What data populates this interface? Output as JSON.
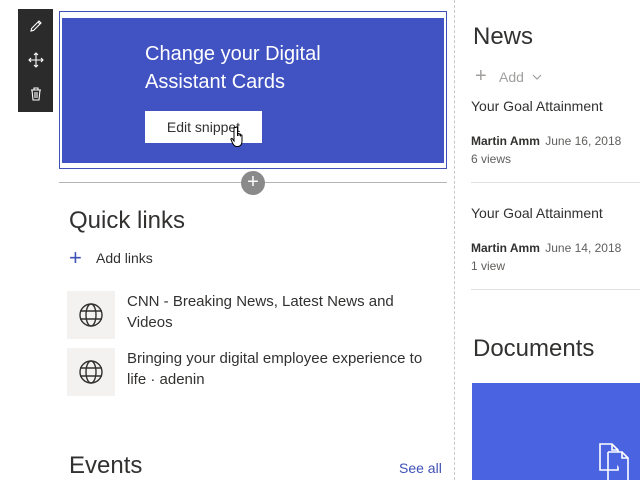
{
  "toolbar": {
    "items": [
      "pencil-icon",
      "move-icon",
      "trash-icon"
    ]
  },
  "banner": {
    "title_line1": "Change your Digital",
    "title_line2": "Assistant Cards",
    "button_label": "Edit snippet",
    "color": "#4153c2"
  },
  "quick_links": {
    "title": "Quick links",
    "add_label": "Add links",
    "items": [
      {
        "line1": "CNN - Breaking News, Latest News and",
        "line2": "Videos"
      },
      {
        "line1": "Bringing your digital employee experience to",
        "line2": "life · adenin"
      }
    ]
  },
  "events": {
    "title": "Events",
    "see_all": "See all"
  },
  "news": {
    "title": "News",
    "add_label": "Add",
    "items": [
      {
        "headline": "Your Goal Attainment",
        "author": "Martin Amm",
        "date": "June 16, 2018",
        "views": "6 views"
      },
      {
        "headline": "Your Goal Attainment",
        "author": "Martin Amm",
        "date": "June 14, 2018",
        "views": "1 view"
      }
    ]
  },
  "documents": {
    "title": "Documents",
    "tile_color": "#4a63e0"
  },
  "colors": {
    "accent": "#3f51b5",
    "toolbar": "#2b2b2b"
  }
}
